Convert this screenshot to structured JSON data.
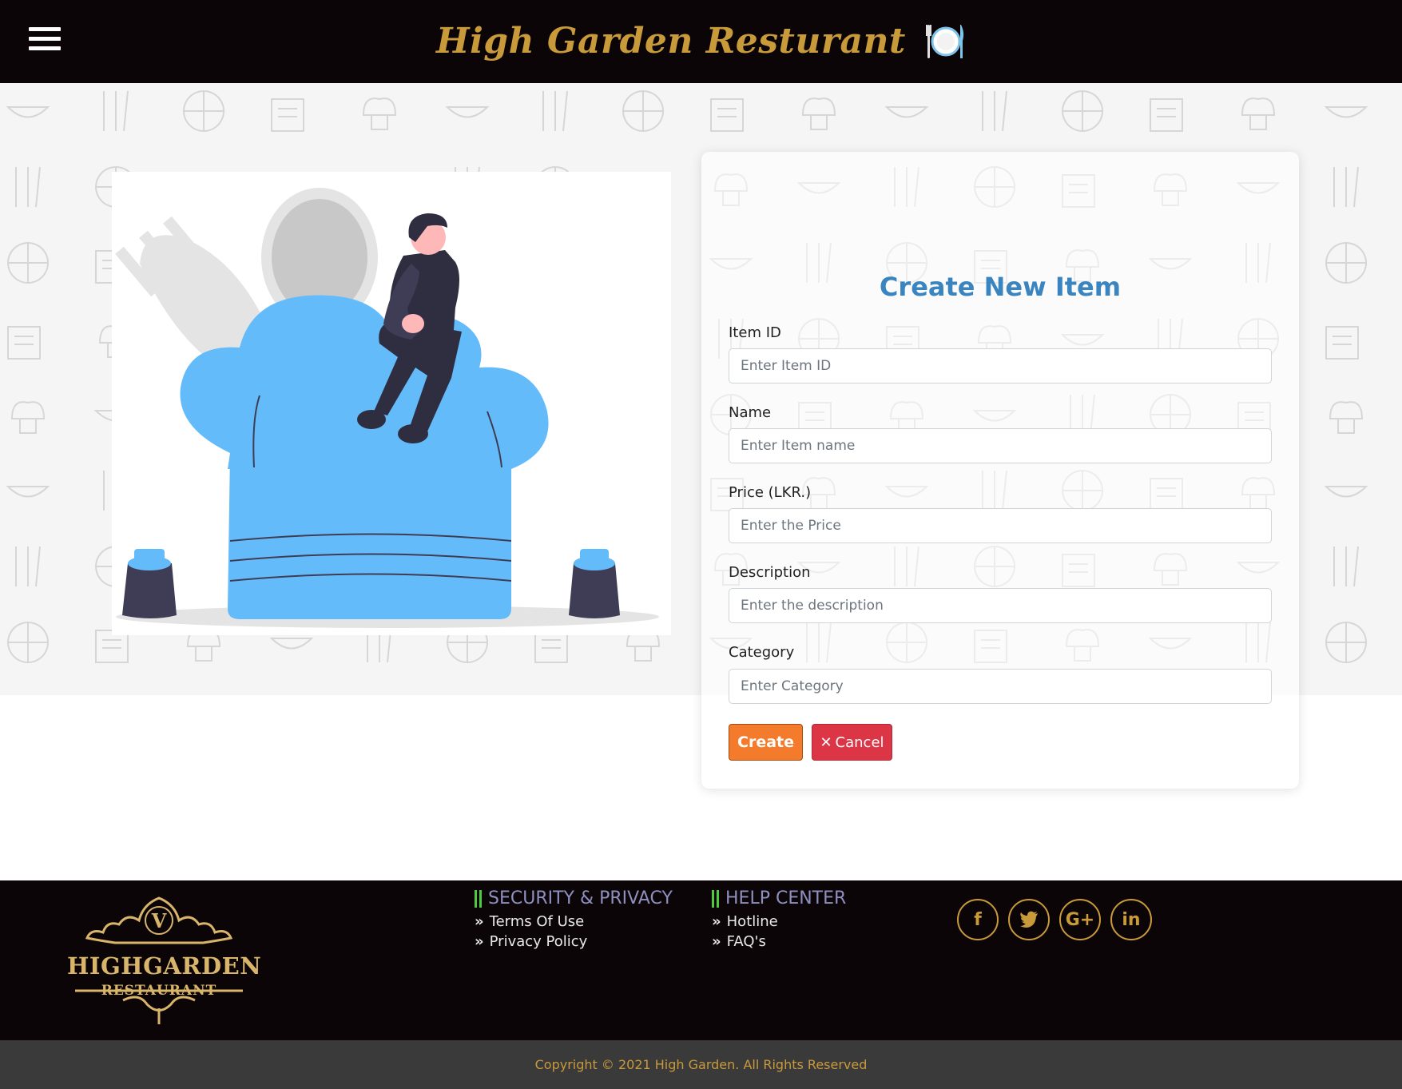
{
  "header": {
    "menu_icon": "hamburger-icon",
    "brand_title": "High Garden Resturant",
    "brand_icon": "plate-cutlery-icon"
  },
  "illustration": {
    "description_icon": "chef-hat-illustration"
  },
  "form": {
    "title": "Create New Item",
    "fields": [
      {
        "label": "Item ID",
        "placeholder": "Enter Item ID",
        "value": ""
      },
      {
        "label": "Name",
        "placeholder": "Enter Item name",
        "value": ""
      },
      {
        "label": "Price (LKR.)",
        "placeholder": "Enter the Price",
        "value": ""
      },
      {
        "label": "Description",
        "placeholder": "Enter the description",
        "value": ""
      },
      {
        "label": "Category",
        "placeholder": "Enter Category",
        "value": ""
      }
    ],
    "create_label": "Create",
    "cancel_label": "Cancel",
    "cancel_icon": "close-icon"
  },
  "footer": {
    "logo": {
      "letter": "V",
      "name": "HIGHGARDEN",
      "sub": "RESTAURANT"
    },
    "security": {
      "heading": "SECURITY & PRIVACY",
      "links": [
        "Terms Of Use",
        "Privacy Policy"
      ]
    },
    "help": {
      "heading": "HELP CENTER",
      "links": [
        "Hotline",
        "FAQ's"
      ]
    },
    "socials": [
      {
        "icon": "facebook-icon",
        "glyph": "f"
      },
      {
        "icon": "twitter-icon",
        "glyph": "t"
      },
      {
        "icon": "google-plus-icon",
        "glyph": "G+"
      },
      {
        "icon": "linkedin-icon",
        "glyph": "in"
      }
    ],
    "copyright": "Copyright © 2021 High Garden. All Rights Reserved"
  },
  "colors": {
    "header_bg": "#0b0507",
    "brand_gold": "#c99a3a",
    "title_blue": "#3a85c0",
    "create_orange": "#f47b2c",
    "cancel_red": "#dc3545",
    "hat_blue": "#63bcf9",
    "copyright_bar": "#3a3a3a"
  }
}
